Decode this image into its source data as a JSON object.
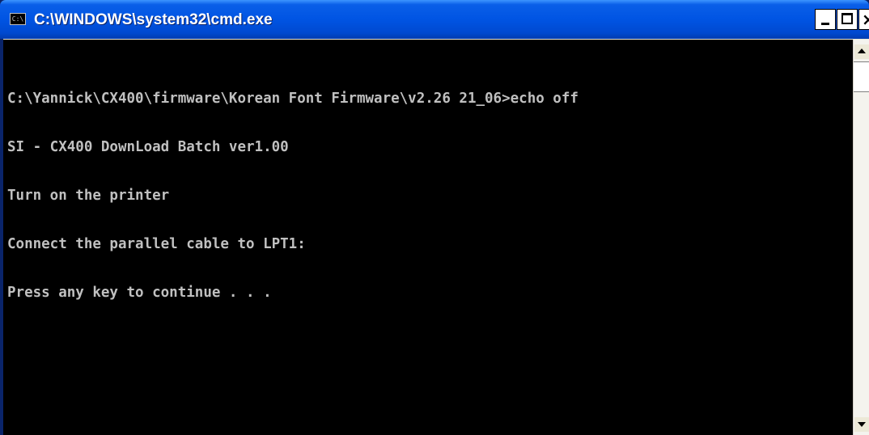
{
  "window": {
    "title": "C:\\WINDOWS\\system32\\cmd.exe",
    "icon": "console-icon",
    "icon_glyph": "C:\\",
    "buttons": {
      "minimize": "minimize-icon",
      "maximize": "maximize-icon",
      "close_glyph": "×"
    }
  },
  "console": {
    "lines": [
      "C:\\Yannick\\CX400\\firmware\\Korean Font Firmware\\v2.26 21_06>echo off",
      "SI - CX400 DownLoad Batch ver1.00",
      "Turn on the printer",
      "Connect the parallel cable to LPT1:",
      "Press any key to continue . . ."
    ]
  },
  "colors": {
    "titlebar": "#0054e3",
    "console_background": "#000000",
    "console_text": "#c0c0c0"
  }
}
